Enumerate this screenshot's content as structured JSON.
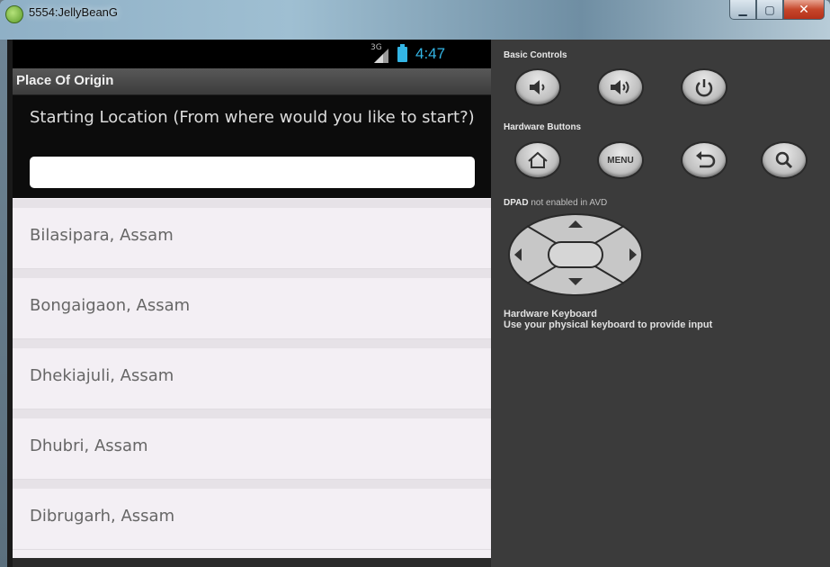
{
  "window": {
    "title": "5554:JellyBeanG",
    "minimize_glyph": "▁",
    "maximize_glyph": "▢",
    "close_glyph": "✕"
  },
  "statusbar": {
    "network": "3G",
    "time": "4:47"
  },
  "app": {
    "title": "Place Of Origin",
    "prompt": "Starting Location (From where would you like to start?)",
    "input_value": "",
    "locations": [
      "Bilasipara, Assam",
      "Bongaigaon, Assam",
      "Dhekiajuli, Assam",
      "Dhubri, Assam",
      "Dibrugarh, Assam"
    ]
  },
  "controls": {
    "basic_label": "Basic Controls",
    "basic_buttons": [
      "volume-down-icon",
      "volume-up-icon",
      "power-icon"
    ],
    "hardware_label": "Hardware Buttons",
    "hardware_buttons": [
      "home-icon",
      "menu-button",
      "back-icon",
      "search-icon"
    ],
    "menu_label": "MENU",
    "dpad_label_strong": "DPAD",
    "dpad_label_rest": " not enabled in AVD",
    "keyboard_title": "Hardware Keyboard",
    "keyboard_desc": "Use your physical keyboard to provide input"
  },
  "colors": {
    "accent": "#33b5e5",
    "phone_bg": "#f3eff4",
    "panel_bg": "#3b3b3b"
  }
}
